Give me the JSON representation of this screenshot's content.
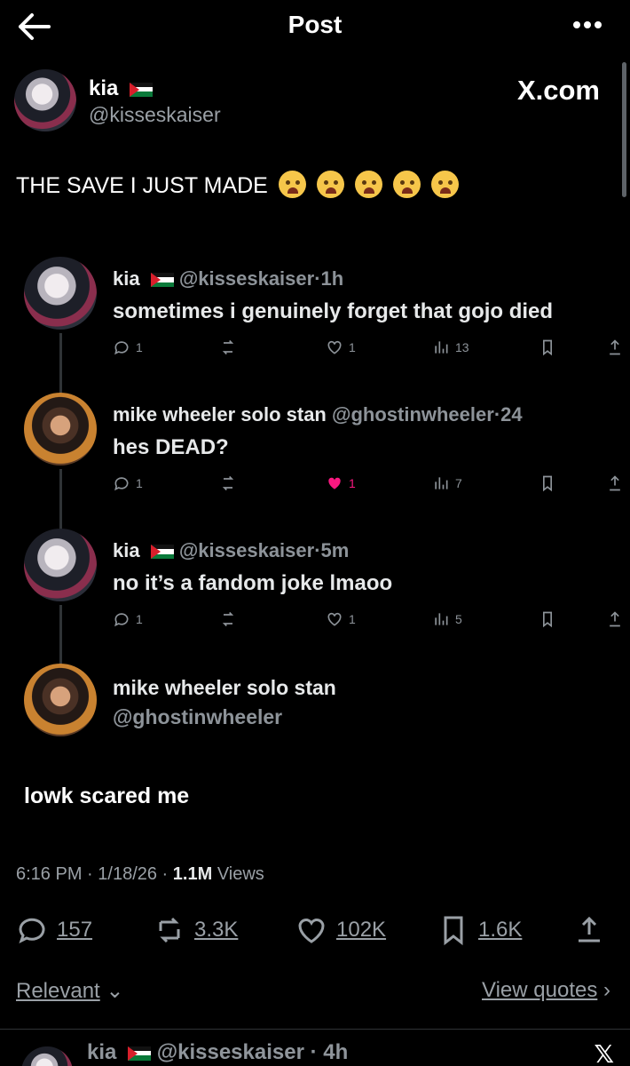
{
  "topbar": {
    "title": "Post"
  },
  "author": {
    "name": "kia",
    "handle": "@kisseskaiser",
    "brand": "X.com"
  },
  "post": {
    "text": "THE SAVE I JUST MADE"
  },
  "replies": [
    {
      "name": "kia",
      "handle": "@kisseskaiser",
      "time": "1h",
      "text": "sometimes i genuinely forget that gojo died",
      "comments": "1",
      "likes": "1",
      "views": "13",
      "liked": false
    },
    {
      "name": "mike wheeler solo stan",
      "handle": "@ghostinwheeler",
      "time": "24",
      "text": "hes DEAD?",
      "comments": "1",
      "likes": "1",
      "views": "7",
      "liked": true
    },
    {
      "name": "kia",
      "handle": "@kisseskaiser",
      "time": "5m",
      "text": "no it’s a fandom joke lmaoo",
      "comments": "1",
      "likes": "1",
      "views": "5",
      "liked": false
    }
  ],
  "last_reply": {
    "name": "mike wheeler solo stan",
    "handle": "@ghostinwheeler"
  },
  "caption": "lowk scared me",
  "meta": {
    "time": "6:16 PM",
    "date": "1/18/26",
    "views": "1.1M",
    "views_label": "Views"
  },
  "stats": {
    "comments": "157",
    "reposts": "3.3K",
    "likes": "102K",
    "bookmarks": "1.6K"
  },
  "footer": {
    "sort": "Relevant",
    "quotes": "View quotes"
  },
  "next_reply": {
    "text": "kia",
    "handle": "@kisseskaiser",
    "time": "4h"
  },
  "colors": {
    "background": "#000000",
    "text": "#e7e9ea",
    "muted": "#9aa0a6",
    "like": "#f91880"
  }
}
